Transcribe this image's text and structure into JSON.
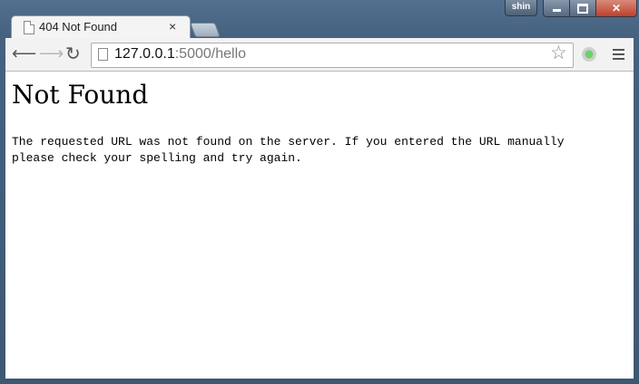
{
  "titlebar": {
    "profile_label": "shin"
  },
  "tab": {
    "title": "404 Not Found"
  },
  "address_bar": {
    "host": "127.0.0.1",
    "rest": ":5000/hello"
  },
  "page": {
    "heading": "Not Found",
    "message": "The requested URL was not found on the server. If you entered the URL manually please check your spelling and try again."
  }
}
